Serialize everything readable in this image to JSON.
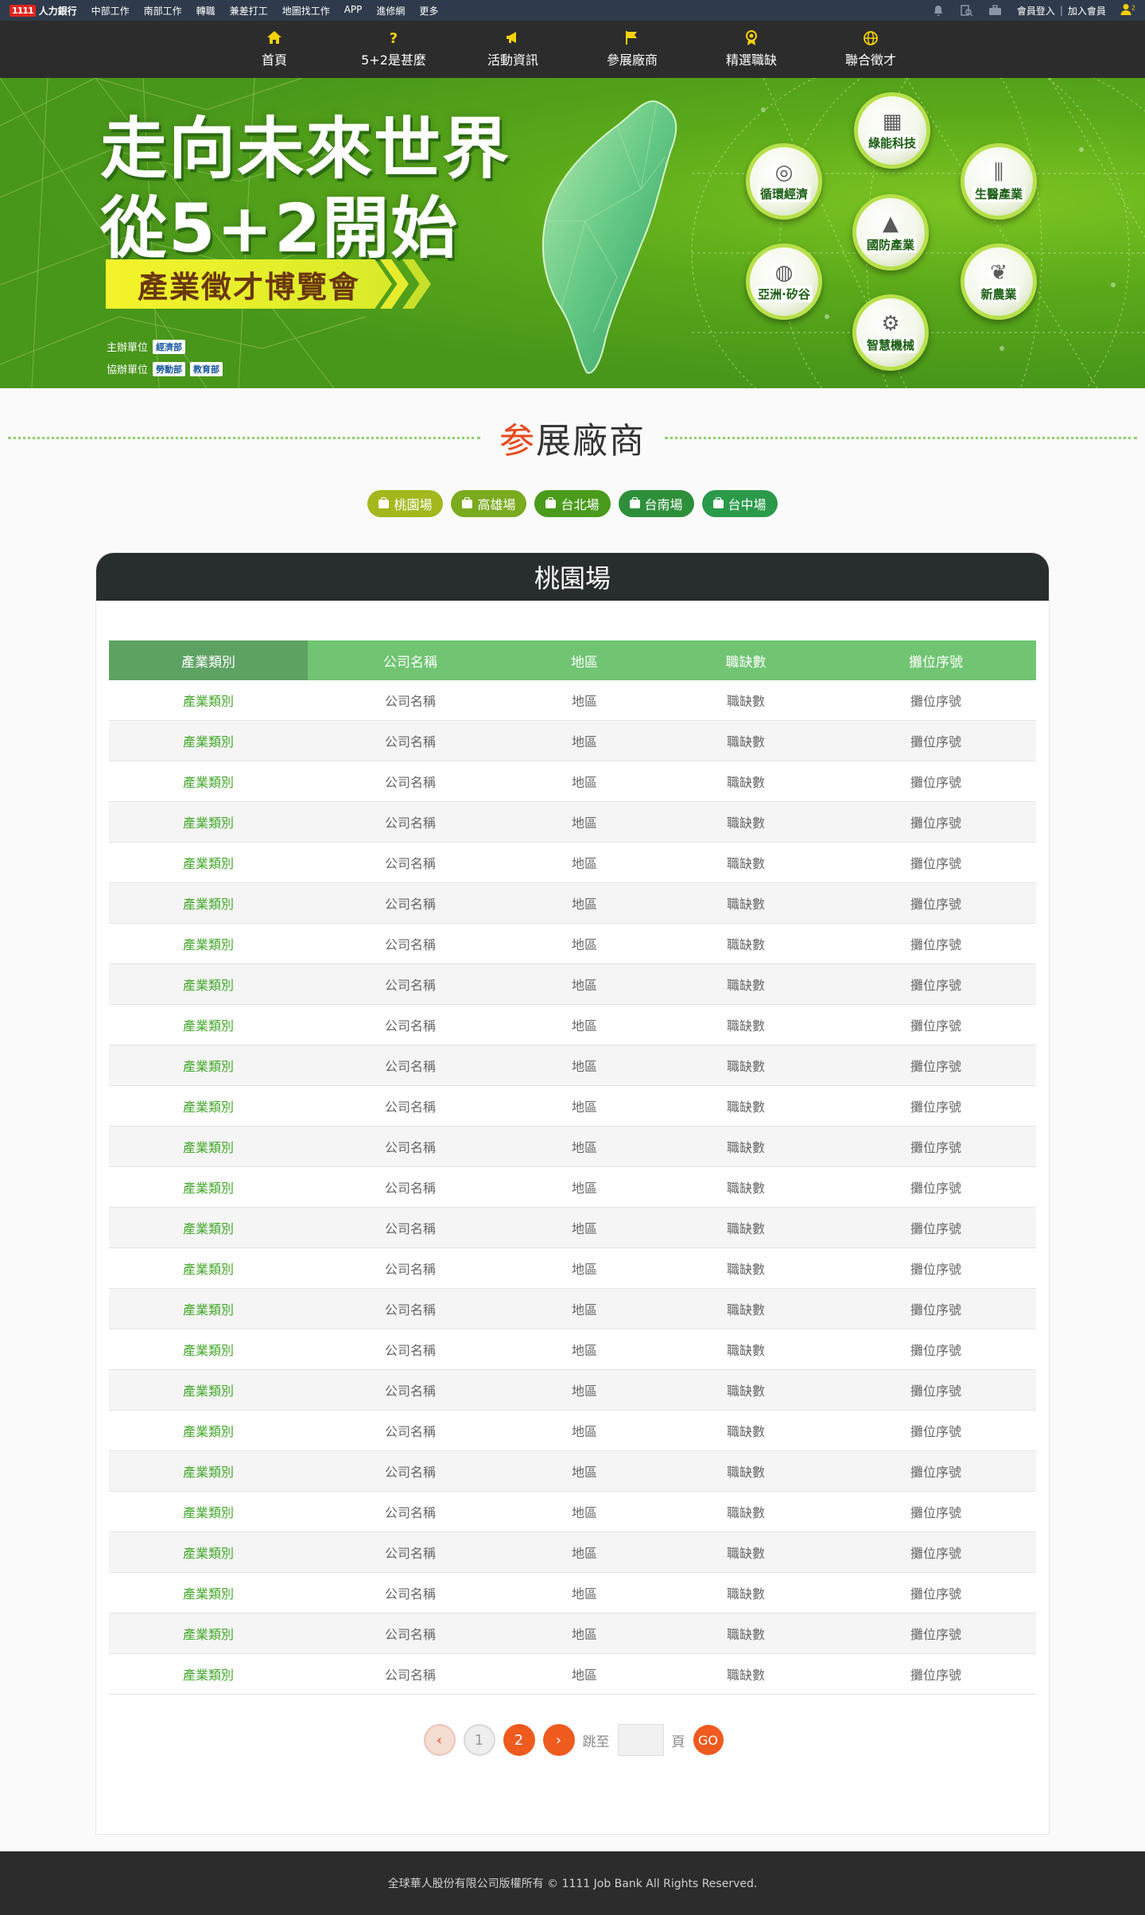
{
  "topbar": {
    "logo_mark": "1111",
    "logo_text": "人力銀行",
    "links": [
      "中部工作",
      "南部工作",
      "轉職",
      "兼差打工",
      "地圖找工作",
      "APP",
      "進修網",
      "更多"
    ],
    "login": "會員登入",
    "separator": "|",
    "join": "加入會員",
    "notification_count": "2"
  },
  "mainnav": {
    "items": [
      {
        "label": "首頁",
        "icon": "home-icon"
      },
      {
        "label": "5+2是甚麼",
        "icon": "question-icon"
      },
      {
        "label": "活動資訊",
        "icon": "megaphone-icon"
      },
      {
        "label": "參展廠商",
        "icon": "flag-icon"
      },
      {
        "label": "精選職缺",
        "icon": "award-icon"
      },
      {
        "label": "聯合徵才",
        "icon": "globe-icon"
      }
    ]
  },
  "banner": {
    "title_line1": "走向未來世界",
    "title_line2": "從5+2開始",
    "subtitle": "產業徵才博覽會",
    "organizer_label": "主辦單位",
    "organizer": "經濟部",
    "co_organizer_label": "協辦單位",
    "co_organizers": [
      "勞動部",
      "教育部"
    ],
    "industries": [
      "綠能科技",
      "循環經濟",
      "生醫產業",
      "國防產業",
      "亞洲·矽谷",
      "新農業",
      "智慧機械"
    ]
  },
  "section": {
    "title_first": "参",
    "title_rest": "展廠商"
  },
  "venues": [
    {
      "label": "桃園場",
      "color": "#a4b71d"
    },
    {
      "label": "高雄場",
      "color": "#7aab1e"
    },
    {
      "label": "台北場",
      "color": "#4a9b1c"
    },
    {
      "label": "台南場",
      "color": "#2e8f3a"
    },
    {
      "label": "台中場",
      "color": "#2a9a4a"
    }
  ],
  "card": {
    "title": "桃園場"
  },
  "table": {
    "headers": [
      "產業類別",
      "公司名稱",
      "地區",
      "職缺數",
      "攤位序號"
    ],
    "rows": [
      [
        "產業類別",
        "公司名稱",
        "地區",
        "職缺數",
        "攤位序號"
      ],
      [
        "產業類別",
        "公司名稱",
        "地區",
        "職缺數",
        "攤位序號"
      ],
      [
        "產業類別",
        "公司名稱",
        "地區",
        "職缺數",
        "攤位序號"
      ],
      [
        "產業類別",
        "公司名稱",
        "地區",
        "職缺數",
        "攤位序號"
      ],
      [
        "產業類別",
        "公司名稱",
        "地區",
        "職缺數",
        "攤位序號"
      ],
      [
        "產業類別",
        "公司名稱",
        "地區",
        "職缺數",
        "攤位序號"
      ],
      [
        "產業類別",
        "公司名稱",
        "地區",
        "職缺數",
        "攤位序號"
      ],
      [
        "產業類別",
        "公司名稱",
        "地區",
        "職缺數",
        "攤位序號"
      ],
      [
        "產業類別",
        "公司名稱",
        "地區",
        "職缺數",
        "攤位序號"
      ],
      [
        "產業類別",
        "公司名稱",
        "地區",
        "職缺數",
        "攤位序號"
      ],
      [
        "產業類別",
        "公司名稱",
        "地區",
        "職缺數",
        "攤位序號"
      ],
      [
        "產業類別",
        "公司名稱",
        "地區",
        "職缺數",
        "攤位序號"
      ],
      [
        "產業類別",
        "公司名稱",
        "地區",
        "職缺數",
        "攤位序號"
      ],
      [
        "產業類別",
        "公司名稱",
        "地區",
        "職缺數",
        "攤位序號"
      ],
      [
        "產業類別",
        "公司名稱",
        "地區",
        "職缺數",
        "攤位序號"
      ],
      [
        "產業類別",
        "公司名稱",
        "地區",
        "職缺數",
        "攤位序號"
      ],
      [
        "產業類別",
        "公司名稱",
        "地區",
        "職缺數",
        "攤位序號"
      ],
      [
        "產業類別",
        "公司名稱",
        "地區",
        "職缺數",
        "攤位序號"
      ],
      [
        "產業類別",
        "公司名稱",
        "地區",
        "職缺數",
        "攤位序號"
      ],
      [
        "產業類別",
        "公司名稱",
        "地區",
        "職缺數",
        "攤位序號"
      ],
      [
        "產業類別",
        "公司名稱",
        "地區",
        "職缺數",
        "攤位序號"
      ],
      [
        "產業類別",
        "公司名稱",
        "地區",
        "職缺數",
        "攤位序號"
      ],
      [
        "產業類別",
        "公司名稱",
        "地區",
        "職缺數",
        "攤位序號"
      ],
      [
        "產業類別",
        "公司名稱",
        "地區",
        "職缺數",
        "攤位序號"
      ],
      [
        "產業類別",
        "公司名稱",
        "地區",
        "職缺數",
        "攤位序號"
      ]
    ]
  },
  "pager": {
    "prev": "‹",
    "pages": [
      "1",
      "2"
    ],
    "current": "2",
    "next": "›",
    "jump_label": "跳至",
    "page_unit": "頁",
    "jump_value": "",
    "go": "GO"
  },
  "footer": {
    "copyright": "全球華人股份有限公司版權所有 © 1111 Job Bank All Rights Reserved."
  }
}
